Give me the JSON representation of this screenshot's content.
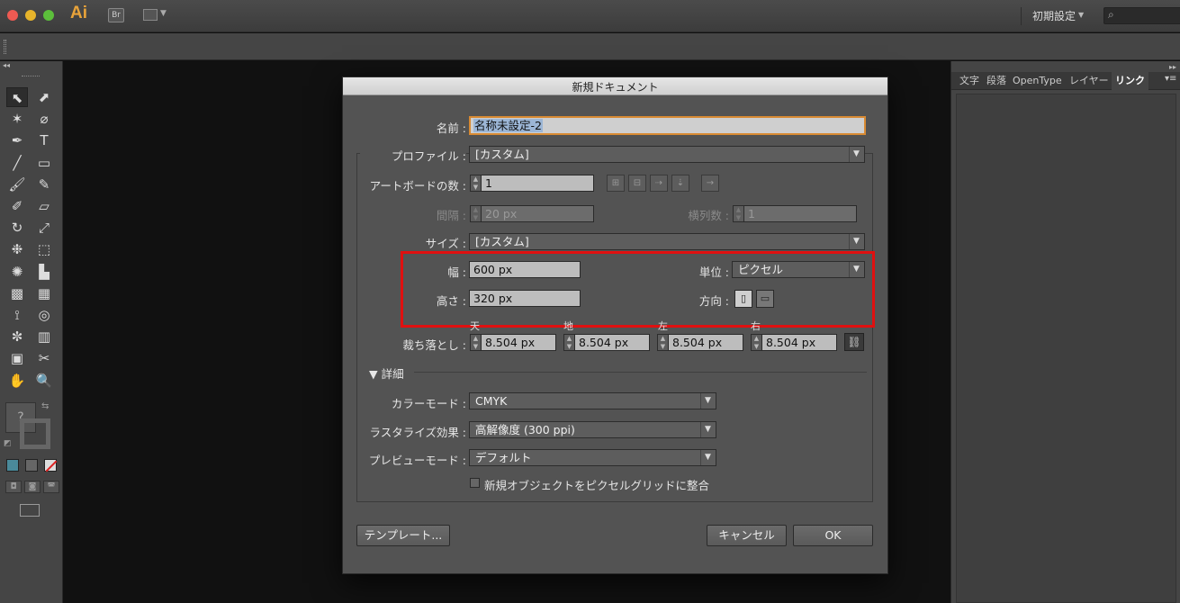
{
  "app": {
    "logo": "Ai",
    "bridge_label": "Br",
    "workspace_label": "初期設定"
  },
  "tools": [
    "selection-tool",
    "direct-selection-tool",
    "magic-wand-tool",
    "lasso-tool",
    "pen-tool",
    "type-tool",
    "line-tool",
    "rectangle-tool",
    "paintbrush-tool",
    "pencil-tool",
    "blob-brush-tool",
    "eraser-tool",
    "rotate-tool",
    "scale-tool",
    "warp-tool",
    "free-transform-tool",
    "shape-builder-tool",
    "graph-tool",
    "mesh-tool",
    "gradient-tool",
    "eyedropper-tool",
    "blend-tool",
    "symbol-sprayer-tool",
    "column-graph-tool",
    "artboard-tool",
    "slice-tool",
    "hand-tool",
    "zoom-tool"
  ],
  "tool_glyphs": [
    "⬉",
    "⬈",
    "✶",
    "⌀",
    "✒",
    "T",
    "╱",
    "▭",
    "🖌",
    "✎",
    "✐",
    "▱",
    "↻",
    "⤢",
    "❉",
    "⬚",
    "✺",
    "▙",
    "▩",
    "▦",
    "⟟",
    "◎",
    "✼",
    "▥",
    "▣",
    "✂",
    "✋",
    "🔍"
  ],
  "fill_placeholder": "?",
  "panel_tabs": [
    "文字",
    "段落",
    "OpenType",
    "レイヤー",
    "リンク"
  ],
  "dialog": {
    "title": "新規ドキュメント",
    "name_label": "名前 :",
    "name_value": "名称未設定-2",
    "profile_label": "プロファイル :",
    "profile_value": "[カスタム]",
    "artboards_label": "アートボードの数 :",
    "artboards_value": "1",
    "spacing_label": "間隔 :",
    "spacing_value": "20 px",
    "columns_label": "横列数 :",
    "columns_value": "1",
    "size_label": "サイズ :",
    "size_value": "[カスタム]",
    "width_label": "幅 :",
    "width_value": "600 px",
    "height_label": "高さ :",
    "height_value": "320 px",
    "units_label": "単位 :",
    "units_value": "ピクセル",
    "orientation_label": "方向 :",
    "bleed_label": "裁ち落とし :",
    "bleed_top_label": "天",
    "bleed_bottom_label": "地",
    "bleed_left_label": "左",
    "bleed_right_label": "右",
    "bleed_top": "8.504 px",
    "bleed_bottom": "8.504 px",
    "bleed_left": "8.504 px",
    "bleed_right": "8.504 px",
    "advanced_label": "詳細",
    "color_mode_label": "カラーモード :",
    "color_mode_value": "CMYK",
    "raster_label": "ラスタライズ効果 :",
    "raster_value": "高解像度 (300 ppi)",
    "preview_label": "プレビューモード :",
    "preview_value": "デフォルト",
    "pixel_grid_label": "新規オブジェクトをピクセルグリッドに整合",
    "template_button": "テンプレート...",
    "cancel_button": "キャンセル",
    "ok_button": "OK"
  }
}
